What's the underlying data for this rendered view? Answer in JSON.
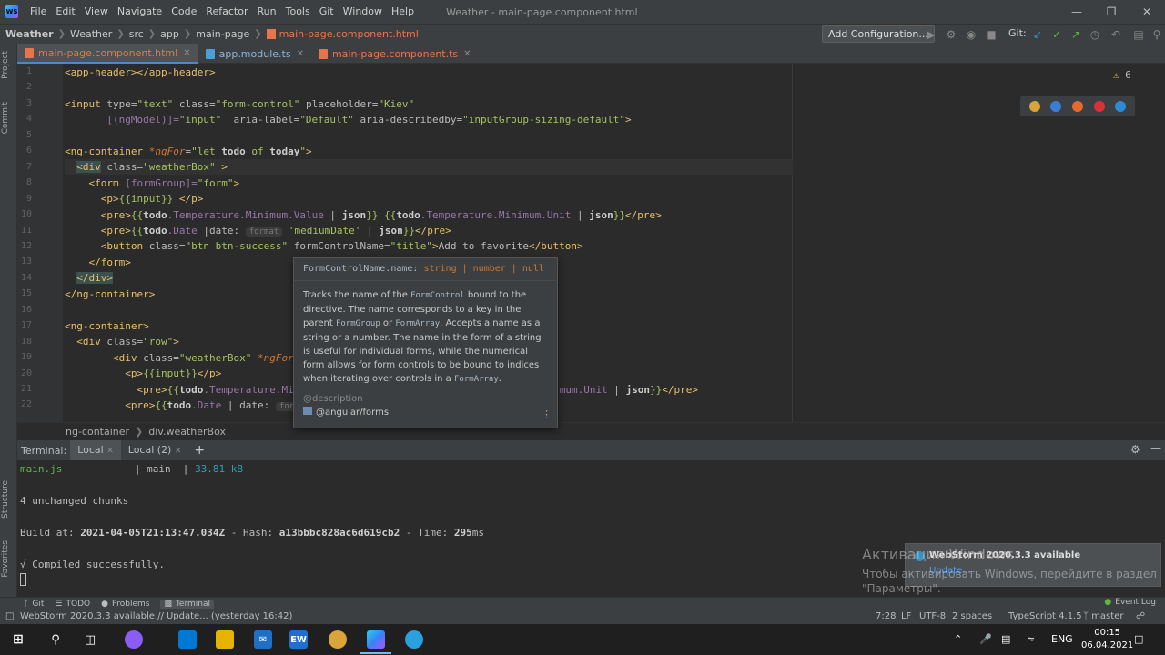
{
  "titlebar": {
    "menu": [
      "File",
      "Edit",
      "View",
      "Navigate",
      "Code",
      "Refactor",
      "Run",
      "Tools",
      "Git",
      "Window",
      "Help"
    ],
    "window_title": "Weather - main-page.component.html"
  },
  "navbar": {
    "crumbs": [
      "Weather",
      "Weather",
      "src",
      "app",
      "main-page",
      "main-page.component.html"
    ],
    "add_config_label": "Add Configuration...",
    "git_label": "Git:"
  },
  "left_strip": {
    "project": "Project",
    "commit": "Commit",
    "structure": "Structure",
    "favorites": "Favorites"
  },
  "tabs": [
    {
      "label": "main-page.component.html",
      "color": "#e8754a"
    },
    {
      "label": "app.module.ts",
      "color": "#4a9fd8"
    },
    {
      "label": "main-page.component.ts",
      "color": "#e8754a"
    }
  ],
  "editor": {
    "warnings": "6",
    "lines": [
      {
        "n": "1"
      },
      {
        "n": "2"
      },
      {
        "n": "3"
      },
      {
        "n": "4"
      },
      {
        "n": "5"
      },
      {
        "n": "6"
      },
      {
        "n": "7"
      },
      {
        "n": "8"
      },
      {
        "n": "9"
      },
      {
        "n": "10"
      },
      {
        "n": "11"
      },
      {
        "n": "12"
      },
      {
        "n": "13"
      },
      {
        "n": "14"
      },
      {
        "n": "15"
      },
      {
        "n": "16"
      },
      {
        "n": "17"
      },
      {
        "n": "18"
      },
      {
        "n": "19"
      },
      {
        "n": "20"
      },
      {
        "n": "21"
      },
      {
        "n": "22"
      }
    ],
    "hint_format": "format"
  },
  "tooltip": {
    "sig_name": "FormControlName.name:",
    "sig_types": "string | number | null",
    "desc_1": "Tracks the name of the ",
    "desc_code_1": "FormControl",
    "desc_2": " bound to the directive. The name corresponds to a key in the parent ",
    "desc_code_2": "FormGroup",
    "desc_3": " or ",
    "desc_code_3": "FormArray",
    "desc_4": ". Accepts a name as a string or a number. The name in the form of a string is useful for individual forms, while the numerical form allows for form controls to be bound to indices when iterating over controls in a ",
    "desc_code_4": "FormArray",
    "desc_5": ".",
    "section": "@description",
    "module": "@angular/forms"
  },
  "code_crumbs": [
    "ng-container",
    "div.weatherBox"
  ],
  "terminal": {
    "label": "Terminal:",
    "tabs": [
      "Local",
      "Local (2)"
    ],
    "line1_file": "main.js",
    "line1_rest": "            | main  | ",
    "line1_size": "33.81 kB",
    "line2": "4 unchanged chunks",
    "build_prefix": "Build at: ",
    "build_date": "2021-04-05T21:13:47.034Z",
    "build_mid": " - Hash: ",
    "build_hash": "a13bbbc828ac6d619cb2",
    "build_time_pre": " - Time: ",
    "build_time": "295",
    "build_time_unit": "ms",
    "compiled": "√ Compiled successfully."
  },
  "notification": {
    "title": "WebStorm 2020.3.3 available",
    "link": "Update..."
  },
  "activation": {
    "title": "Активация Windows",
    "sub1": "Чтобы активировать Windows, перейдите в раздел",
    "sub2": "\"Параметры\"."
  },
  "bottom_tools": [
    "Git",
    "TODO",
    "Problems",
    "Terminal"
  ],
  "event_log": "Event Log",
  "status": {
    "message": "WebStorm 2020.3.3 available // Update... (yesterday 16:42)",
    "position": "7:28",
    "line_sep": "LF",
    "encoding": "UTF-8",
    "indent": "2 spaces",
    "lang": "TypeScript 4.1.5",
    "branch": "master"
  },
  "taskbar": {
    "lang": "ENG",
    "time": "00:15",
    "date": "06.04.2021",
    "ew_label": "EW"
  },
  "colors": {
    "accent": "#4a88c7",
    "tag": "#e8bf6a",
    "string": "#a5c261",
    "keyword": "#cc7832",
    "angular": "#9876aa"
  }
}
